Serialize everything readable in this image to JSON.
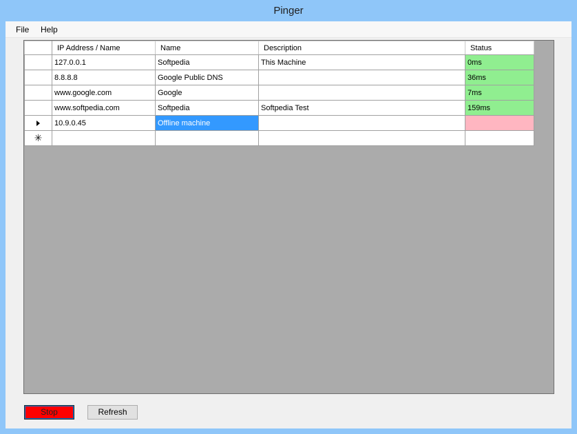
{
  "window": {
    "title": "Pinger"
  },
  "menu": {
    "items": [
      "File",
      "Help"
    ]
  },
  "grid": {
    "columns": [
      "IP Address / Name",
      "Name",
      "Description",
      "Status"
    ],
    "rows": [
      {
        "ip": "127.0.0.1",
        "name": "Softpedia",
        "description": "This Machine",
        "status": "0ms",
        "state": "ok"
      },
      {
        "ip": "8.8.8.8",
        "name": "Google Public DNS",
        "description": "",
        "status": "36ms",
        "state": "ok"
      },
      {
        "ip": "www.google.com",
        "name": "Google",
        "description": "",
        "status": "7ms",
        "state": "ok"
      },
      {
        "ip": "www.softpedia.com",
        "name": "Softpedia",
        "description": "Softpedia Test",
        "status": "159ms",
        "state": "ok"
      },
      {
        "ip": "10.9.0.45",
        "name": "Offline machine",
        "description": "",
        "status": "",
        "state": "bad"
      }
    ],
    "new_row_marker": "✳",
    "colors": {
      "ok": "#90ee90",
      "bad": "#ffb6c1",
      "selection": "#3399ff"
    }
  },
  "buttons": {
    "stop": "Stop",
    "refresh": "Refresh"
  }
}
